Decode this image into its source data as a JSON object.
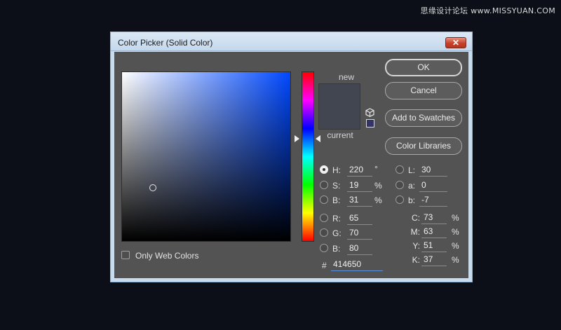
{
  "watermark": "思缘设计论坛 www.MISSYUAN.COM",
  "window": {
    "title": "Color Picker (Solid Color)",
    "close_label": "✕"
  },
  "preview": {
    "new_label": "new",
    "current_label": "current",
    "new_color": "#414650",
    "current_color": "#414650",
    "websafe_color": "#333366"
  },
  "buttons": {
    "ok": "OK",
    "cancel": "Cancel",
    "add_to_swatches": "Add to Swatches",
    "color_libraries": "Color Libraries"
  },
  "only_web_colors": {
    "label": "Only Web Colors",
    "checked": false
  },
  "hsb": {
    "h": {
      "label": "H:",
      "value": "220",
      "unit": "°",
      "selected": true
    },
    "s": {
      "label": "S:",
      "value": "19",
      "unit": "%"
    },
    "b": {
      "label": "B:",
      "value": "31",
      "unit": "%"
    }
  },
  "rgb": {
    "r": {
      "label": "R:",
      "value": "65"
    },
    "g": {
      "label": "G:",
      "value": "70"
    },
    "b": {
      "label": "B:",
      "value": "80"
    }
  },
  "lab": {
    "l": {
      "label": "L:",
      "value": "30"
    },
    "a": {
      "label": "a:",
      "value": "0"
    },
    "b": {
      "label": "b:",
      "value": "-7"
    }
  },
  "cmyk": {
    "c": {
      "label": "C:",
      "value": "73",
      "unit": "%"
    },
    "m": {
      "label": "M:",
      "value": "63",
      "unit": "%"
    },
    "y": {
      "label": "Y:",
      "value": "51",
      "unit": "%"
    },
    "k": {
      "label": "K:",
      "value": "37",
      "unit": "%"
    }
  },
  "hex": {
    "label": "#",
    "value": "414650"
  }
}
